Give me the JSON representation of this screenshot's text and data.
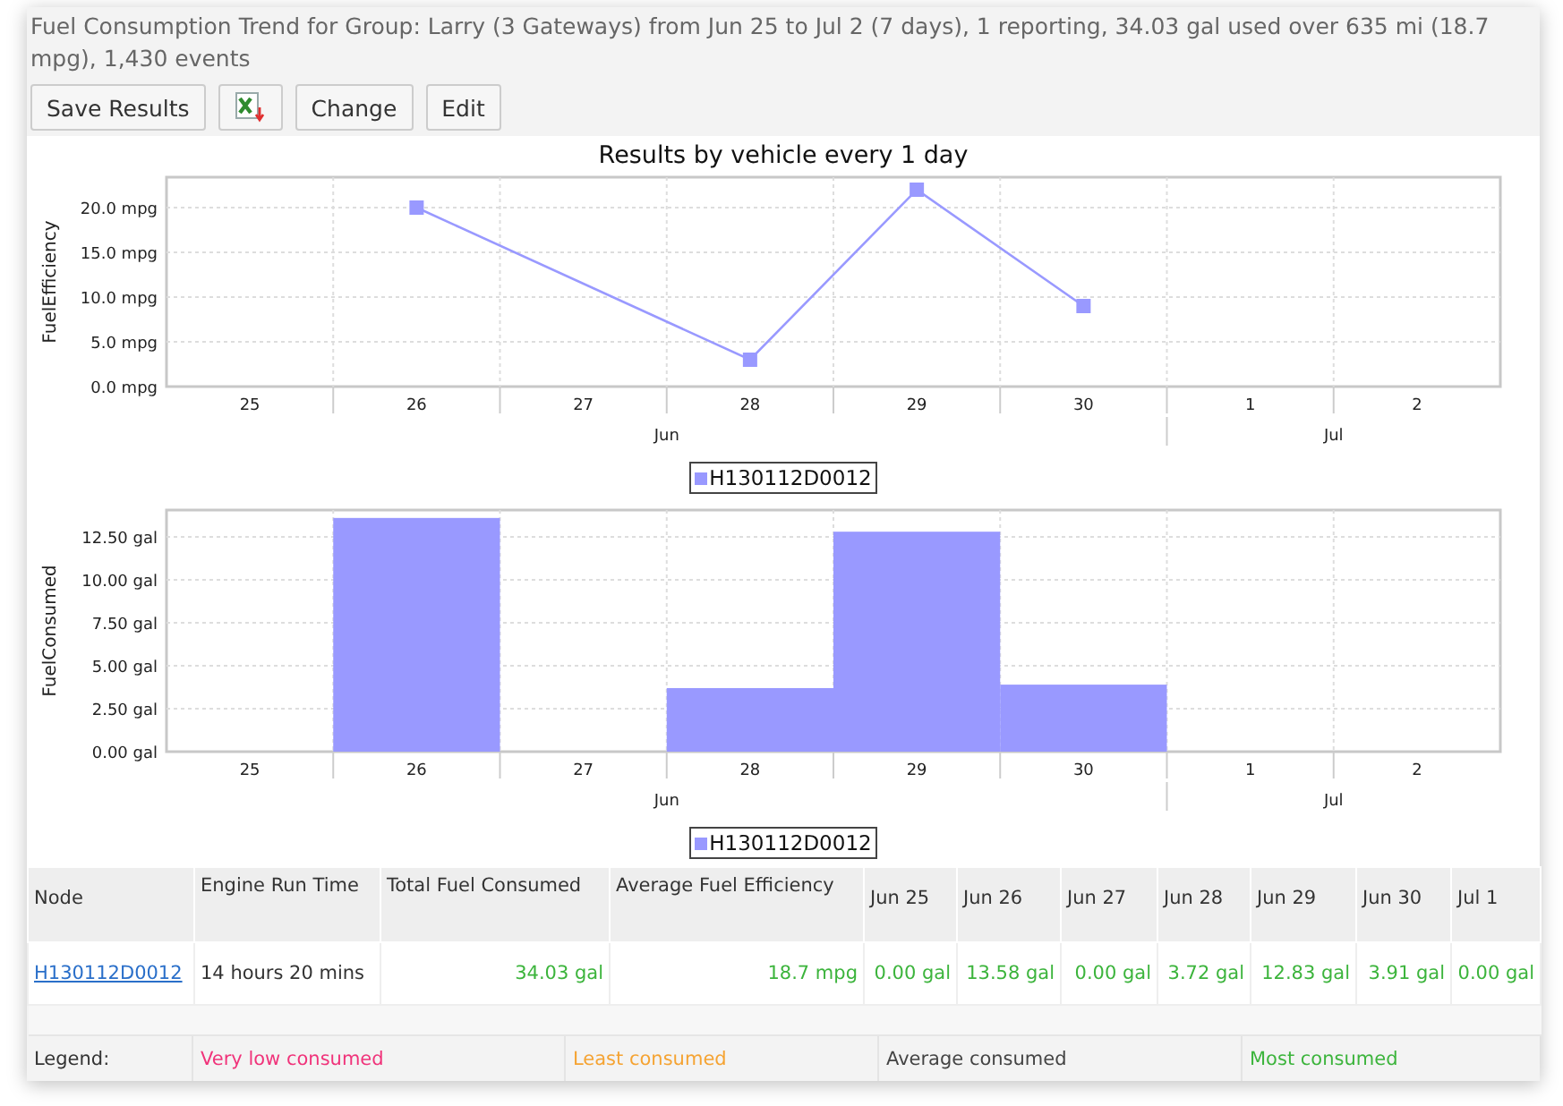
{
  "header": {
    "title": "Fuel Consumption Trend for Group: Larry (3 Gateways) from Jun 25 to Jul 2 (7 days), 1 reporting, 34.03 gal used over 635 mi (18.7 mpg), 1,430 events"
  },
  "toolbar": {
    "buttons": [
      {
        "kind": "text",
        "label": "Save Results"
      },
      {
        "kind": "spreadsheet"
      },
      {
        "kind": "text",
        "label": "Change"
      },
      {
        "kind": "text",
        "label": "Edit"
      }
    ]
  },
  "charts": {
    "title": "Results by vehicle every 1 day",
    "panels": [
      {
        "chart_data": {
          "type": "line",
          "ylabel": "FuelEfficiency",
          "categories": [
            "25",
            "26",
            "27",
            "28",
            "29",
            "30",
            "1",
            "2"
          ],
          "grid": true,
          "series": [
            {
              "name": "H130112D0012",
              "color": "#9999ff",
              "marker": "square",
              "values": [
                null,
                20,
                null,
                3,
                22,
                9,
                null,
                null
              ]
            }
          ],
          "ylim": [
            0,
            23.4
          ],
          "yticks": [
            {
              "value": 0,
              "label": "0.0 mpg"
            },
            {
              "value": 5,
              "label": "5.0 mpg"
            },
            {
              "value": 10,
              "label": "10.0 mpg"
            },
            {
              "value": 15,
              "label": "15.0 mpg"
            },
            {
              "value": 20,
              "label": "20.0 mpg"
            }
          ]
        },
        "months": [
          "Jun",
          "Jul"
        ]
      },
      {
        "chart_data": {
          "type": "bar",
          "ylabel": "FuelConsumed",
          "categories": [
            "25",
            "26",
            "27",
            "28",
            "29",
            "30",
            "1",
            "2"
          ],
          "grid": true,
          "series": [
            {
              "name": "H130112D0012",
              "color": "#9999ff",
              "values": [
                0,
                13.6,
                0,
                3.7,
                12.8,
                3.9,
                0,
                0
              ]
            }
          ],
          "ylim": [
            0,
            14.06
          ],
          "yticks": [
            {
              "value": 0,
              "label": "0.00 gal"
            },
            {
              "value": 2.5,
              "label": "2.50 gal"
            },
            {
              "value": 5,
              "label": "5.00 gal"
            },
            {
              "value": 7.5,
              "label": "7.50 gal"
            },
            {
              "value": 10,
              "label": "10.00 gal"
            },
            {
              "value": 12.5,
              "label": "12.50 gal"
            }
          ]
        },
        "months": [
          "Jun",
          "Jul"
        ]
      }
    ]
  },
  "table": {
    "columns": [
      "Node",
      "Engine Run Time",
      "Total Fuel Consumed",
      "Average Fuel Efficiency",
      "Jun 25",
      "Jun 26",
      "Jun 27",
      "Jun 28",
      "Jun 29",
      "Jun 30",
      "Jul 1"
    ],
    "rows": [
      {
        "cells": [
          {
            "kind": "link",
            "text": "H130112D0012"
          },
          {
            "kind": "text",
            "text": "14 hours 20 mins"
          },
          {
            "kind": "value",
            "text": "34.03 gal",
            "color": "#3cb43c"
          },
          {
            "kind": "value",
            "text": "18.7 mpg",
            "color": "#3cb43c"
          },
          {
            "kind": "value",
            "text": "0.00 gal",
            "color": "#3cb43c"
          },
          {
            "kind": "value",
            "text": "13.58 gal",
            "color": "#3cb43c"
          },
          {
            "kind": "value",
            "text": "0.00 gal",
            "color": "#3cb43c"
          },
          {
            "kind": "value",
            "text": "3.72 gal",
            "color": "#3cb43c"
          },
          {
            "kind": "value",
            "text": "12.83 gal",
            "color": "#3cb43c"
          },
          {
            "kind": "value",
            "text": "3.91 gal",
            "color": "#3cb43c"
          },
          {
            "kind": "value",
            "text": "0.00 gal",
            "color": "#3cb43c"
          }
        ]
      }
    ]
  },
  "legend": {
    "label": "Legend:",
    "items": [
      {
        "text": "Very low consumed",
        "color": "#f0337a"
      },
      {
        "text": "Least consumed",
        "color": "#f5a332"
      },
      {
        "text": "Average consumed",
        "color": "#444444"
      },
      {
        "text": "Most consumed",
        "color": "#3cb43c"
      }
    ]
  }
}
